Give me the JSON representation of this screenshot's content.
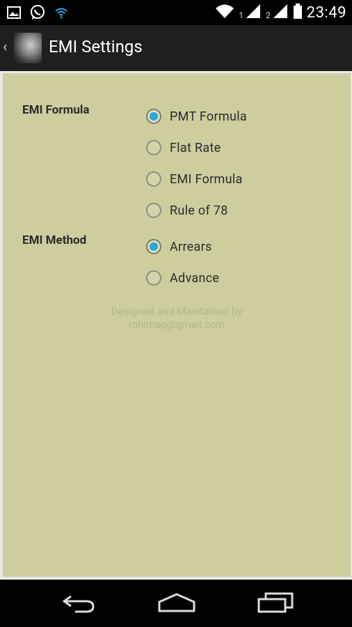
{
  "status_bar": {
    "left_icons": [
      "image-icon",
      "whatsapp-icon",
      "wifi-signal-icon"
    ],
    "right_icons": [
      "wifi-icon",
      "signal-icon",
      "signal-icon",
      "battery-icon"
    ],
    "sim1": "1",
    "sim2": "2",
    "time": "23:49"
  },
  "action_bar": {
    "title": "EMI Settings"
  },
  "settings": {
    "emi_formula": {
      "label": "EMI Formula",
      "options": [
        "PMT Formula",
        "Flat Rate",
        "EMI Formula",
        "Rule of 78"
      ],
      "selected": "PMT Formula"
    },
    "emi_method": {
      "label": "EMI Method",
      "options": [
        "Arrears",
        "Advance"
      ],
      "selected": "Arrears"
    }
  },
  "credit": {
    "line1": "Designed and Maintained by",
    "line2": "rohithsp@gmail.com"
  },
  "nav_bar": {
    "buttons": [
      "back-icon",
      "home-icon",
      "recent-apps-icon"
    ]
  },
  "colors": {
    "content_bg": "#cdcd9e",
    "accent": "#28a7d9",
    "actionbar_bg": "#1f1f1f"
  }
}
